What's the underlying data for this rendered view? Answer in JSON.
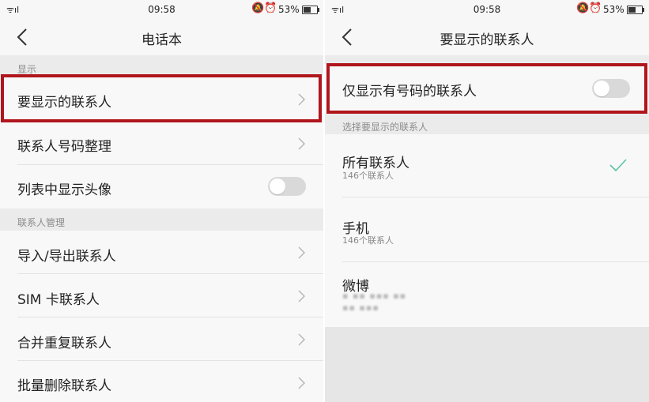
{
  "status": {
    "signal_text": "ᯤıl",
    "time": "09:58",
    "alarm_icons": "🔕⏰",
    "battery": "53%"
  },
  "left": {
    "title": "电话本",
    "section_display": "显示",
    "item_contacts_to_show": "要显示的联系人",
    "item_organize_numbers": "联系人号码整理",
    "item_show_avatars": "列表中显示头像",
    "section_manage": "联系人管理",
    "item_import_export": "导入/导出联系人",
    "item_sim": "SIM  卡联系人",
    "item_merge": "合并重复联系人",
    "item_batch_delete": "批量删除联系人",
    "toggle_show_avatars": "off"
  },
  "right": {
    "title": "要显示的联系人",
    "item_only_with_number": "仅显示有号码的联系人",
    "toggle_only_with_number": "off",
    "section_choose": "选择要显示的联系人",
    "options": [
      {
        "label": "所有联系人",
        "count": "146个联系人",
        "selected": true
      },
      {
        "label": "手机",
        "count": "146个联系人",
        "selected": false
      },
      {
        "label": "微博",
        "count_blurred_line1": "▪ ▪▪ ▪▪▪ ▪▪",
        "count_blurred_line2": "▪▪ ▪▪▪",
        "selected": false
      }
    ]
  },
  "colors": {
    "highlight": "#b0161c",
    "checkmark": "#5cc3a6",
    "row_bg": "#f8f8f8",
    "section_bg": "#ebebeb"
  }
}
